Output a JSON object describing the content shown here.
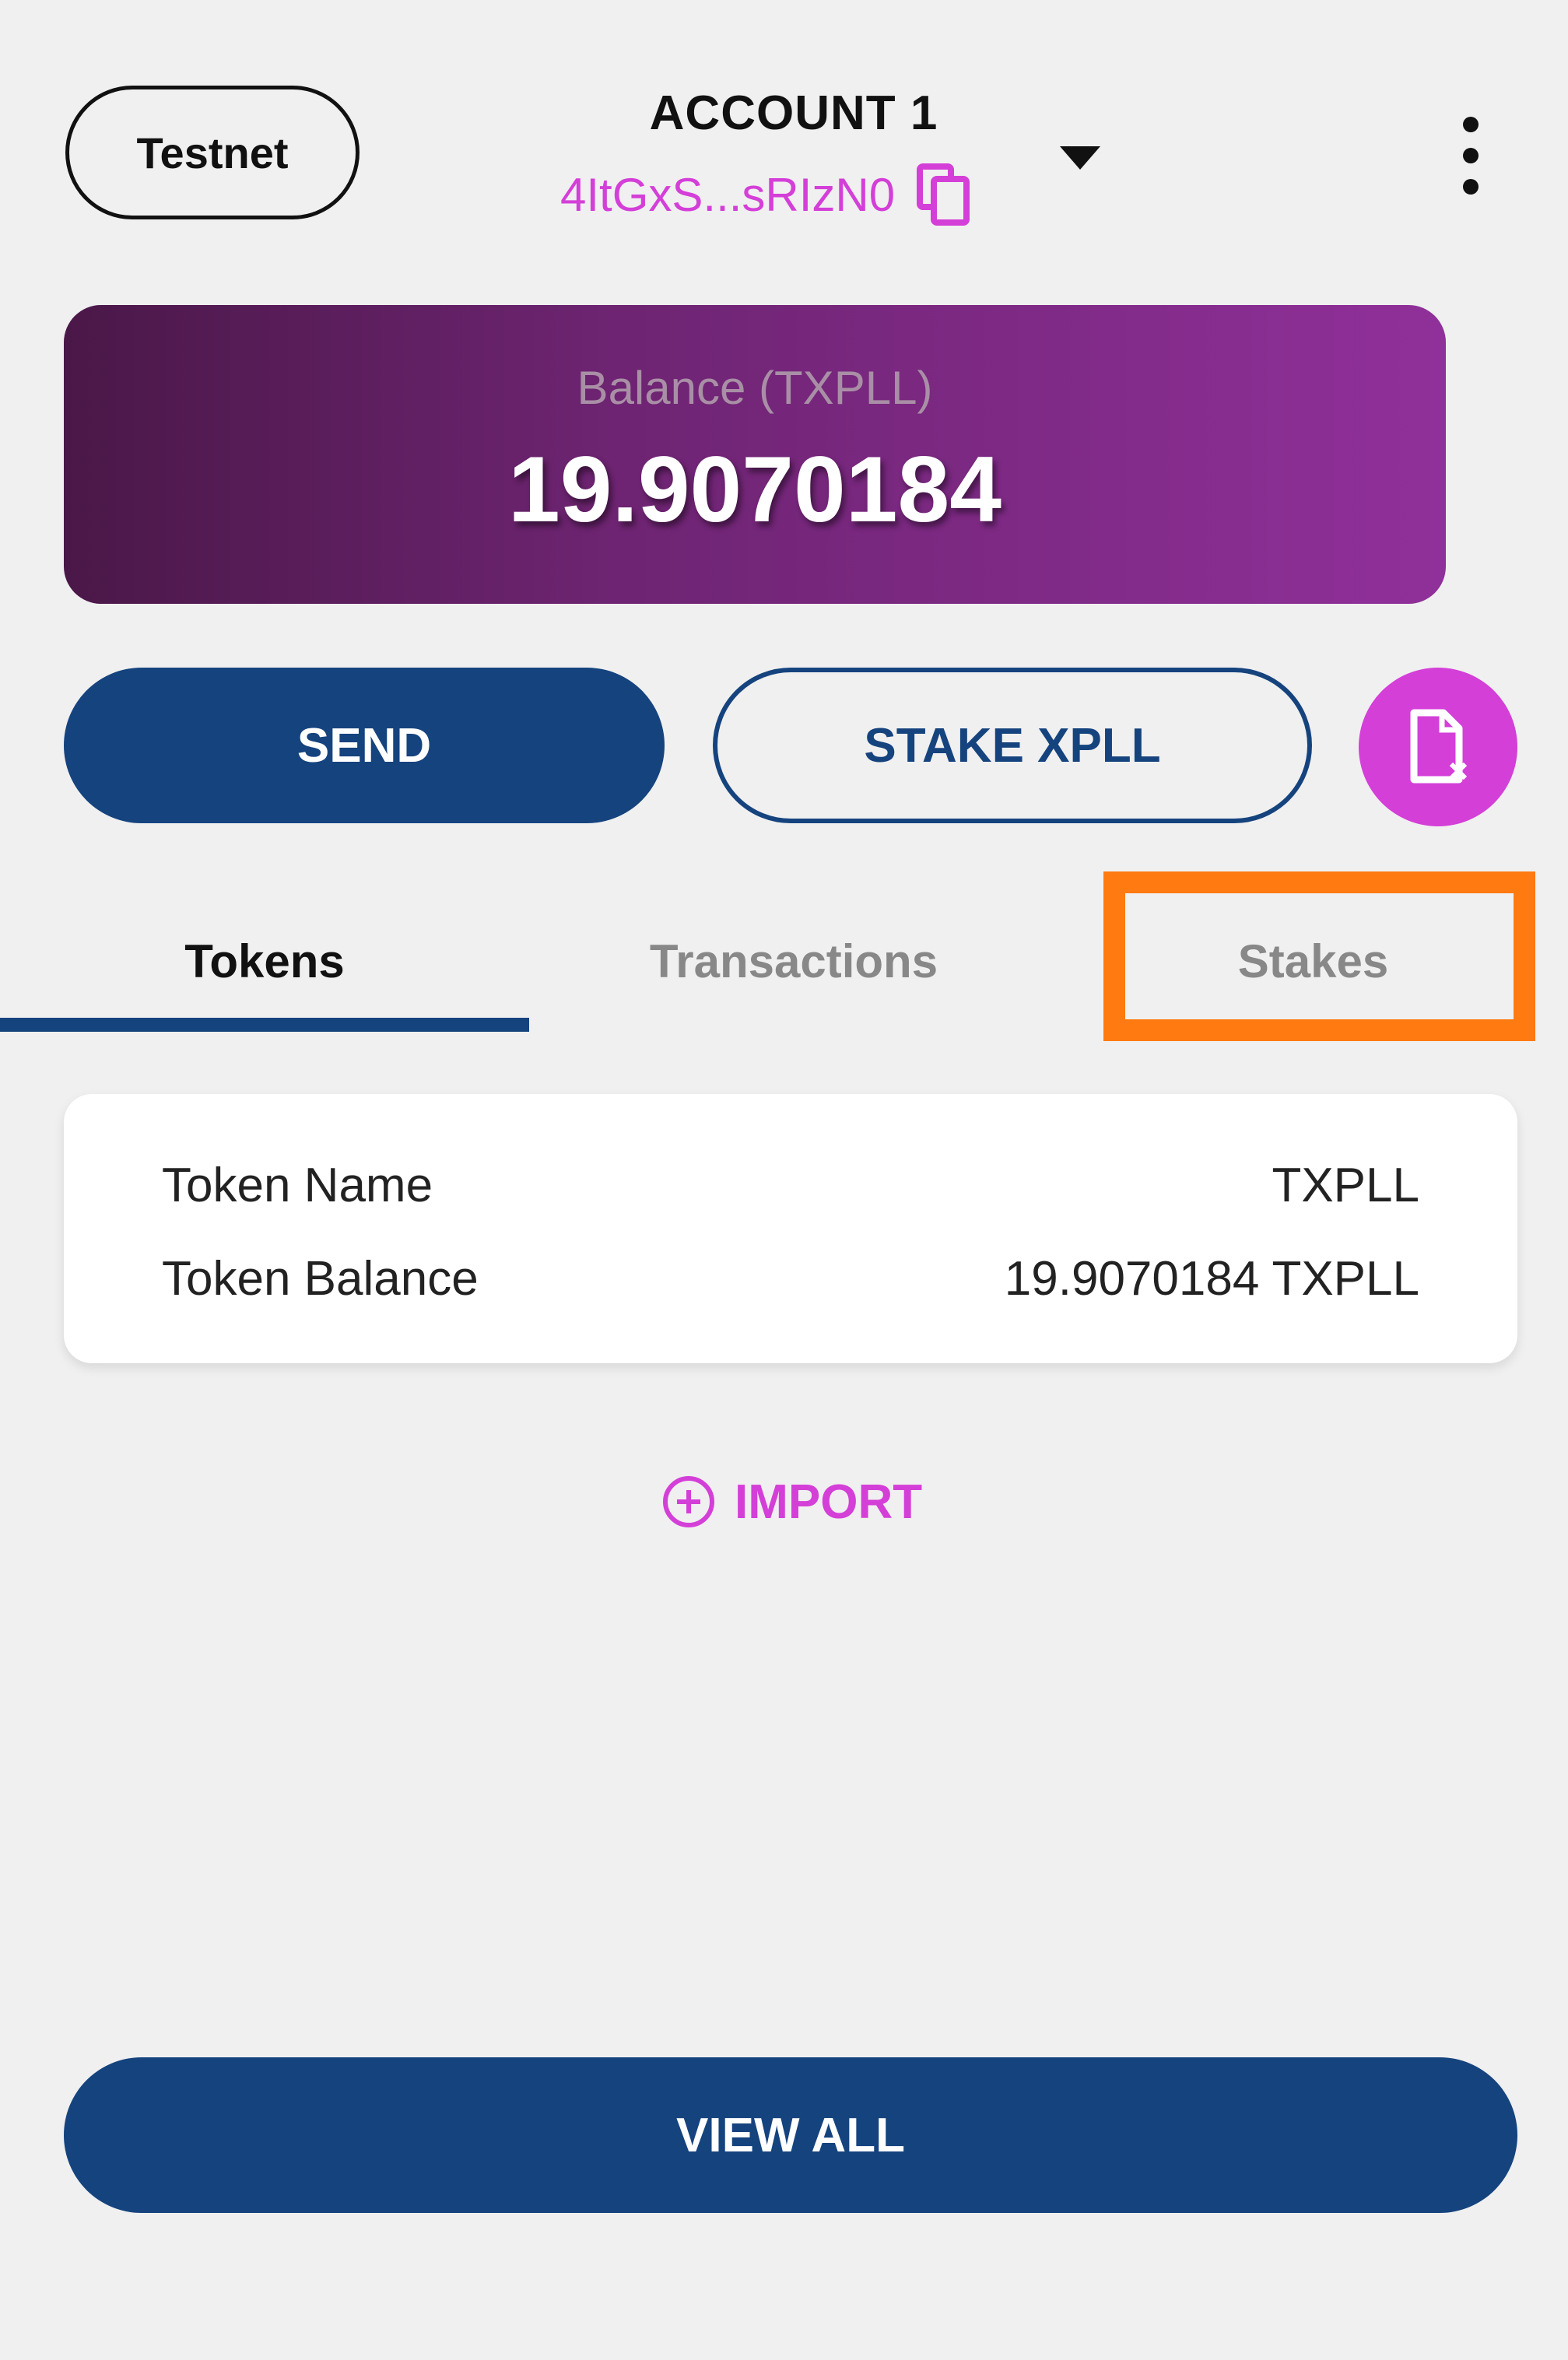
{
  "header": {
    "network_label": "Testnet",
    "account_name": "ACCOUNT 1",
    "account_address": "4ItGxS...sRIzN0",
    "icons": {
      "copy": "copy-icon",
      "dropdown": "chevron-down-icon",
      "menu": "more-vertical-icon"
    }
  },
  "balance": {
    "label": "Balance (TXPLL)",
    "value": "19.9070184"
  },
  "actions": {
    "send_label": "SEND",
    "stake_label": "STAKE XPLL",
    "doc_icon": "document-icon"
  },
  "tabs": [
    {
      "label": "Tokens",
      "active": true
    },
    {
      "label": "Transactions",
      "active": false
    },
    {
      "label": "Stakes",
      "active": false
    }
  ],
  "token_card": {
    "rows": [
      {
        "label": "Token Name",
        "value": "TXPLL"
      },
      {
        "label": "Token Balance",
        "value": "19.9070184 TXPLL"
      }
    ]
  },
  "import_label": "IMPORT",
  "view_all_label": "VIEW ALL",
  "colors": {
    "primary": "#15437e",
    "accent": "#d43fd8",
    "highlight": "#ff7a10",
    "background": "#f0f0f0"
  }
}
